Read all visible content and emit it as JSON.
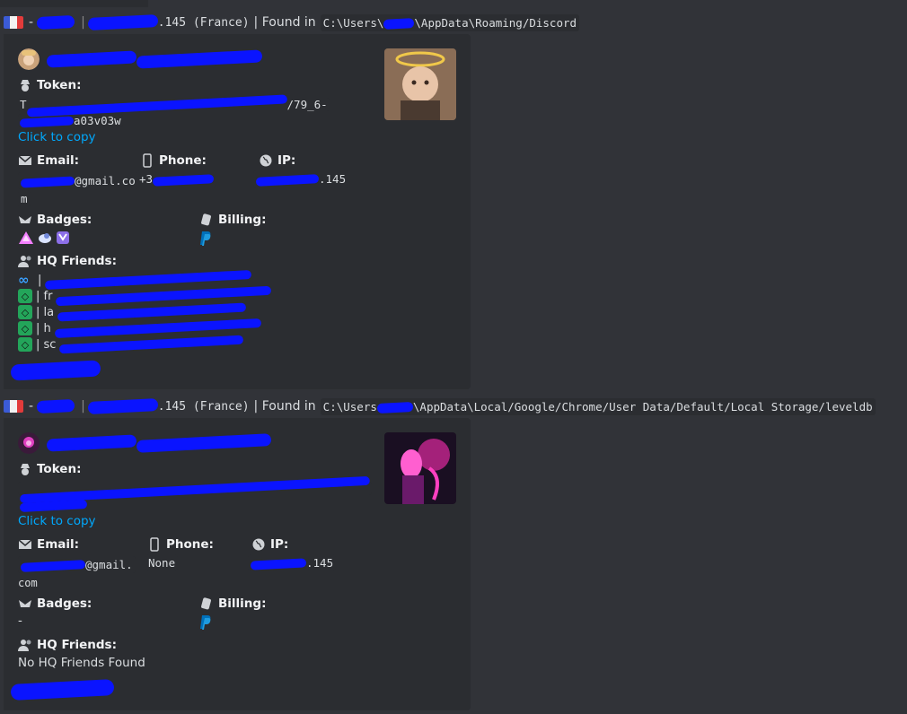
{
  "entries": [
    {
      "header": {
        "dash": "-",
        "ip_suffix": ".145 (France)",
        "found_in": "| Found in",
        "path_prefix": "C:\\Users\\",
        "path_suffix": "\\AppData\\Roaming/Discord"
      },
      "embed": {
        "token_label": "Token:",
        "token_line1_suffix": "/79_6-",
        "token_line2_suffix": "a03v03w",
        "copy_label": "Click to copy",
        "email_label": "Email:",
        "email_value_a": "@gmail.co",
        "email_value_b": "m",
        "phone_label": "Phone:",
        "phone_value": "+3",
        "ip_label": "IP:",
        "ip_value": ".145",
        "badges_label": "Badges:",
        "billing_label": "Billing:",
        "friends_label": "HQ Friends:",
        "friends": [
          {
            "icon": "infinity",
            "text": "| "
          },
          {
            "icon": "nitro",
            "text": "| fr"
          },
          {
            "icon": "nitro",
            "text": "| la"
          },
          {
            "icon": "nitro",
            "text": "| h"
          },
          {
            "icon": "nitro",
            "text": "| sc"
          }
        ]
      }
    },
    {
      "header": {
        "dash": "-",
        "ip_suffix": ".145 (France)",
        "found_in": "| Found in",
        "path_prefix": "C:\\Users",
        "path_suffix": "\\AppData\\Local/Google/Chrome/User Data/Default/Local Storage/leveldb"
      },
      "embed": {
        "token_label": "Token:",
        "token_line1_suffix": "",
        "token_line2_suffix": "",
        "copy_label": "Click to copy",
        "email_label": "Email:",
        "email_value_a": "@gmail.",
        "email_value_b": "com",
        "phone_label": "Phone:",
        "phone_value": "None",
        "ip_label": "IP:",
        "ip_value": ".145",
        "badges_label": "Badges:",
        "badges_value": "-",
        "billing_label": "Billing:",
        "friends_label": "HQ Friends:",
        "friends_value": "No HQ Friends Found"
      }
    }
  ],
  "colors": {
    "background": "#313338",
    "embed_bg": "#2b2d31",
    "link": "#00a8fc",
    "redaction": "#0a14ff"
  }
}
